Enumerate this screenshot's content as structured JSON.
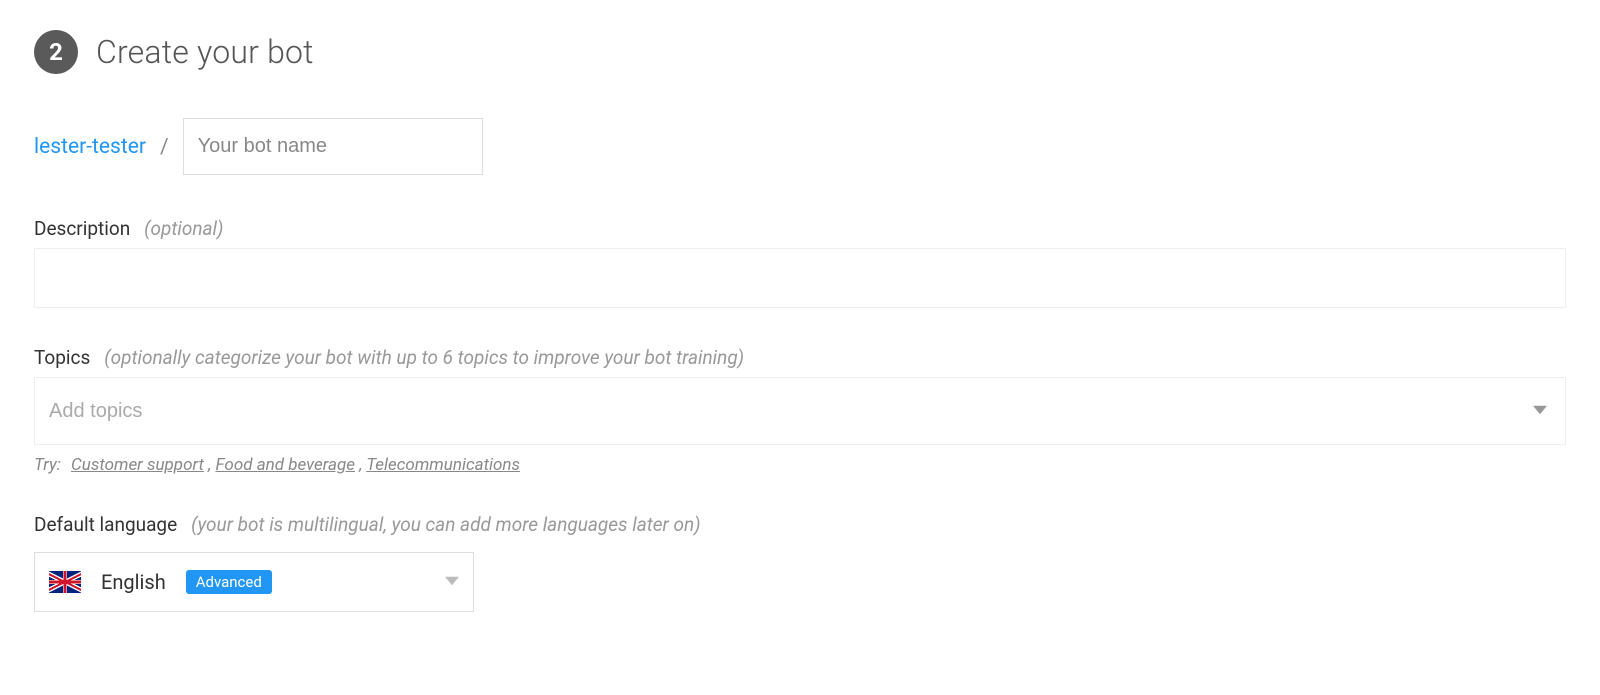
{
  "step": {
    "number": "2",
    "title": "Create your bot"
  },
  "org": {
    "name": "lester-tester"
  },
  "separator": "/",
  "botName": {
    "placeholder": "Your bot name",
    "value": ""
  },
  "description": {
    "label": "Description",
    "hint": "(optional)",
    "value": ""
  },
  "topics": {
    "label": "Topics",
    "hint": "(optionally categorize your bot with up to 6 topics to improve your bot training)",
    "placeholder": "Add topics",
    "tryLabel": "Try:",
    "suggestions": [
      "Customer support",
      "Food and beverage",
      "Telecommunications"
    ]
  },
  "language": {
    "label": "Default language",
    "hint": "(your bot is multilingual, you can add more languages later on)",
    "selected": "English",
    "badge": "Advanced"
  }
}
